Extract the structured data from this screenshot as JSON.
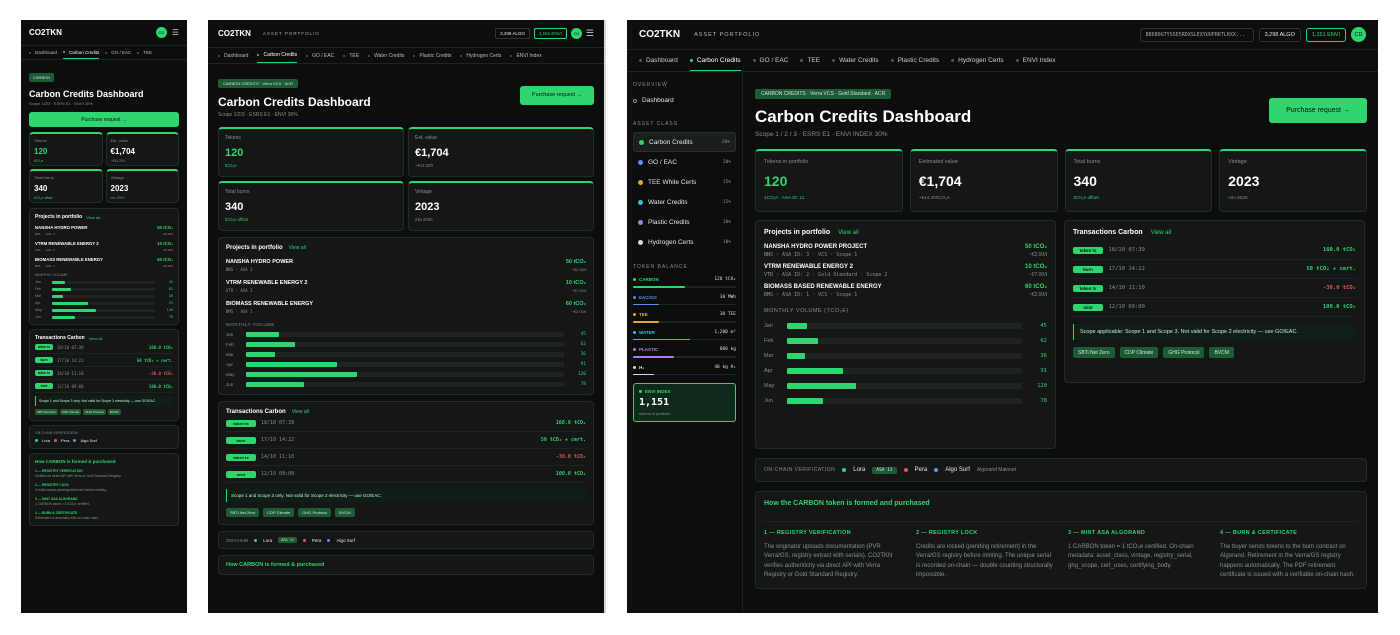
{
  "brand": "CO2TKN",
  "portfolio_label": "ASSET PORTFOLIO",
  "wallet": "BB6B0GTYSSD5RDXSLEXYUUPRKTLRXX...",
  "algo": "3,298 ALGO",
  "envi": "1,151 ENVI",
  "avatar": "CD",
  "tabs": [
    "Dashboard",
    "Carbon Credits",
    "GO / EAC",
    "TEE",
    "Water Credits",
    "Plastic Credits",
    "Hydrogen Certs",
    "ENVI Index"
  ],
  "tabs_short": [
    "Dashboard",
    "Carbon Credits",
    "GO / EAC",
    "TEE"
  ],
  "tag_full": "CARBON CREDITS · Verra VCS · Gold Standard · ACR",
  "tag_mid": "CARBON CREDITS · Verra VCS · ACR",
  "tag_short": "CARBON",
  "title": "Carbon Credits Dashboard",
  "subtitle_full": "Scope 1 / 2 / 3 · ESRS E1 · ENVI INDEX 30%",
  "subtitle_mid": "Scope 1/2/3 · ESRS E1 · ENVI 30%",
  "purchase": "Purchase request →",
  "kpis": [
    {
      "label": "Tokens in portfolio",
      "short": "Tokens",
      "value": "120",
      "sub": "1CO₂e · ASA ID: 11",
      "sub_short": "tCO₂e",
      "green": true
    },
    {
      "label": "Estimated value",
      "short": "Est. value",
      "value": "€1,704",
      "sub": "~€14.20/tCO₂e",
      "sub_short": "~€14.20/t",
      "green": false
    },
    {
      "label": "Total burns",
      "short": "Total burns",
      "value": "340",
      "sub": "tCO₂e offset",
      "sub_short": "tCO₂e offset",
      "green": false
    },
    {
      "label": "Vintage",
      "short": "Vintage",
      "value": "2023",
      "sub": "min 2020",
      "sub_short": "min 2020",
      "green": false
    }
  ],
  "projects_title": "Projects in portfolio",
  "view_all": "View all",
  "projects": [
    {
      "name": "NANSHA HYDRO POWER PROJECT",
      "short": "NANSHA HYDRO POWER",
      "meta": "NNS · ASA ID: 3 · VCS · Scope 1",
      "meta_short": "NNS · ASA 3",
      "qty": "50 tCO₂",
      "price": "~€2.00/t"
    },
    {
      "name": "VTRM RENEWABLE ENERGY 2",
      "short": "VTRM RENEWABLE ENERGY 2",
      "meta": "VTR · ASA ID: 2 · Gold Standard · Scope 2",
      "meta_short": "VTR · ASA 2",
      "qty": "10 tCO₂",
      "price": "~€7.00/t"
    },
    {
      "name": "BIOMASS BASED RENEWABLE ENERGY",
      "short": "BIOMASS RENEWABLE ENERGY",
      "meta": "BMS · ASA ID: 1 · VCS · Scope 1",
      "meta_short": "BMS · ASA 1",
      "qty": "60 tCO₂",
      "price": "~€2.00/t"
    }
  ],
  "monthly_title": "MONTHLY VOLUME (TCO₂E)",
  "monthly_short": "MONTHLY VOLUME",
  "months": [
    {
      "m": "Jan",
      "v": "45",
      "frac": 0.08
    },
    {
      "m": "Feb",
      "v": "62",
      "frac": 0.12
    },
    {
      "m": "Mar",
      "v": "36",
      "frac": 0.07
    },
    {
      "m": "Apr",
      "v": "91",
      "frac": 0.22
    },
    {
      "m": "May",
      "v": "120",
      "frac": 0.27
    },
    {
      "m": "Jun",
      "v": "78",
      "frac": 0.14
    }
  ],
  "tx_title": "Transactions Carbon",
  "txs": [
    {
      "type": "token tx",
      "date": "18/10 07:39",
      "amt": "160.0 tCO₂",
      "color": "g"
    },
    {
      "type": "burn",
      "date": "17/10 14:22",
      "amt": "50 tCO₂ + cert.",
      "color": "g"
    },
    {
      "type": "token tx",
      "date": "14/10 11:10",
      "amt": "-30.0 tCO₂",
      "color": "r"
    },
    {
      "type": "mint",
      "date": "12/10 09:00",
      "amt": "100.0 tCO₂",
      "color": "g"
    }
  ],
  "scope_note": "Scope applicable: Scope 1 and Scope 3. Not valid for Scope 2 electricity — use GO/EAC.",
  "scope_note_mid": "Scope 1 and Scope 3 only. Not valid for Scope 2 electricity — use GO/EAC.",
  "badges": [
    "SBTi Net Zero",
    "CDP Climate",
    "GHG Protocol",
    "BVCM"
  ],
  "sidebar": {
    "overview": "OVERVIEW",
    "dashboard": "Dashboard",
    "asset_class": "ASSET CLASS",
    "assets": [
      {
        "name": "Carbon Credits",
        "pct": "30%",
        "color": "#2fd56e"
      },
      {
        "name": "GO / EAC",
        "pct": "20%",
        "color": "#5b8ff0"
      },
      {
        "name": "TEE White Certs",
        "pct": "15%",
        "color": "#e0a630"
      },
      {
        "name": "Water Credits",
        "pct": "15%",
        "color": "#3dbbe0"
      },
      {
        "name": "Plastic Credits",
        "pct": "10%",
        "color": "#b07be6"
      },
      {
        "name": "Hydrogen Certs",
        "pct": "10%",
        "color": "#d8dbd9"
      }
    ],
    "token_balance": "TOKEN BALANCE",
    "balances": [
      {
        "name": "CARBON",
        "v": "120 tCO₂",
        "color": "#2fd56e",
        "frac": 0.5
      },
      {
        "name": "EAC/GO",
        "v": "30 MWh",
        "color": "#5b8ff0",
        "frac": 0.25
      },
      {
        "name": "TEE",
        "v": "30 TEE",
        "color": "#e0a630",
        "frac": 0.25
      },
      {
        "name": "WATER",
        "v": "1,200 m³",
        "color": "#3dbbe0",
        "frac": 0.55
      },
      {
        "name": "PLASTIC",
        "v": "800 kg",
        "color": "#b07be6",
        "frac": 0.4
      },
      {
        "name": "H₂",
        "v": "40 kg H₂",
        "color": "#d8dbd9",
        "frac": 0.2
      }
    ],
    "envi_label": "ENVI INDEX",
    "envi_value": "1,151",
    "envi_sub": "tokens in portfolio"
  },
  "onchain": {
    "label": "ON-CHAIN VERIFICATION",
    "label_short": "ON-CHAIN",
    "lora": "Lora",
    "asa": "ASA 11",
    "pera": "Pera",
    "algosurf": "Algo Surf",
    "network": "Algorand Mainnet"
  },
  "how_title": "How the CARBON token is formed and purchased",
  "how_title_short": "How CARBON is formed & purchased",
  "steps": [
    {
      "t": "1 — REGISTRY VERIFICATION",
      "d": "The originator uploads documentation (PVR Verra/GS, registry extract with serials). CO2TKN verifies authenticity via direct API with Verra Registry or Gold Standard Registry.",
      "s": "Verified via direct API with Verra or Gold Standard Registry."
    },
    {
      "t": "2 — REGISTRY LOCK",
      "d": "Credits are locked (pending retirement) in the Verra/GS registry before minting. The unique serial is recorded on-chain — double counting structurally impossible.",
      "s": "Credits locked pending retirement before minting."
    },
    {
      "t": "3 — MINT ASA ALGORAND",
      "d": "1 CARBON token = 1 tCO₂e certified. On-chain metadata: asset_class, vintage, registry_serial, ghg_scope, cert_uses, certifying_body.",
      "s": "1 CARBON token = 1 tCO₂e certified."
    },
    {
      "t": "4 — BURN & CERTIFICATE",
      "d": "The buyer sends tokens to the burn contract on Algorand. Retirement in the Verra/GS registry happens automatically. The PDF retirement certificate is issued with a verifiable on-chain hash.",
      "s": "Retirement is automatic with on-chain hash."
    }
  ]
}
